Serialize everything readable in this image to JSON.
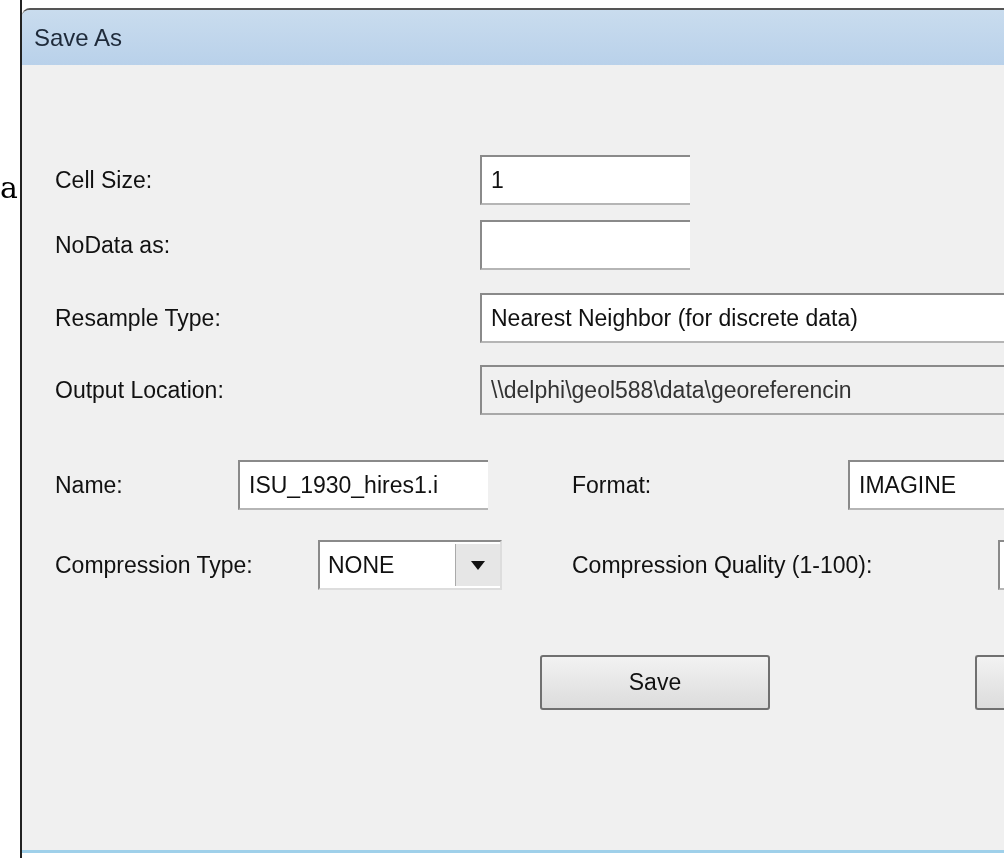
{
  "background_text": "a",
  "window": {
    "title": "Save As"
  },
  "fields": [
    {
      "label": "Cell Size:",
      "value": "1",
      "disabled": false,
      "wide": false
    },
    {
      "label": "NoData as:",
      "disabled": false,
      "wide": false
    },
    {
      "label": "Resample Type:",
      "value": "Nearest Neighbor (for discrete data)",
      "disabled": false,
      "wide": true
    },
    {
      "label": "Output Location:",
      "value": "\\\\delphi\\geol588\\data\\georeferencin",
      "disabled": true,
      "wide": true
    }
  ],
  "name": {
    "label": "Name:",
    "value": "ISU_1930_hires1.i"
  },
  "format": {
    "label": "Format:",
    "value": "IMAGINE"
  },
  "compression_type": {
    "label": "Compression Type:",
    "value": "NONE"
  },
  "compression_quality": {
    "label": "Compression Quality (1-100):"
  },
  "buttons": [
    "Save"
  ]
}
